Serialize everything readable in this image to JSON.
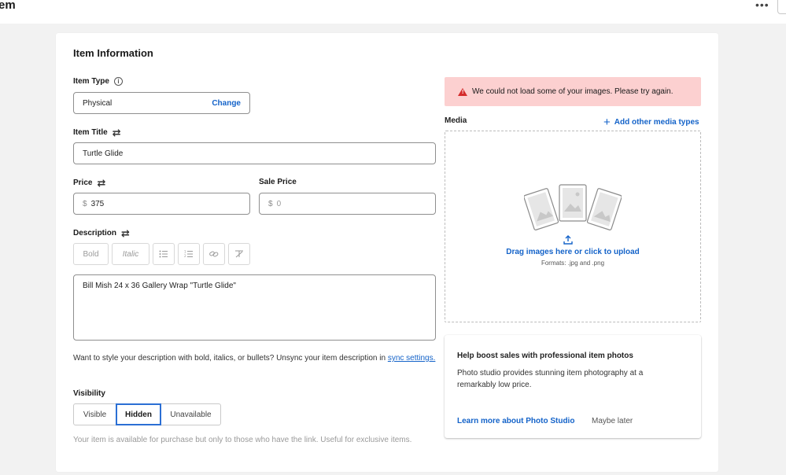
{
  "header": {
    "title": "em",
    "more_icon": "more-horizontal-icon"
  },
  "form": {
    "section_title": "Item Information",
    "item_type": {
      "label": "Item Type",
      "value": "Physical",
      "change_label": "Change"
    },
    "item_title": {
      "label": "Item Title",
      "value": "Turtle Glide"
    },
    "price": {
      "label": "Price",
      "currency": "$",
      "value": "375"
    },
    "sale_price": {
      "label": "Sale Price",
      "currency": "$",
      "placeholder": "0"
    },
    "description": {
      "label": "Description",
      "toolbar": {
        "bold": "Bold",
        "italic": "Italic"
      },
      "value": "Bill Mish 24 x 36 Gallery Wrap \"Turtle Glide\"",
      "help_text": "Want to style your description with bold, italics, or bullets? Unsync your item description in ",
      "help_link": "sync settings."
    },
    "visibility": {
      "label": "Visibility",
      "options": [
        "Visible",
        "Hidden",
        "Unavailable"
      ],
      "selected": "Hidden",
      "help": "Your item is available for purchase but only to those who have the link. Useful for exclusive items."
    }
  },
  "media": {
    "alert": "We could not load some of your images. Please try again.",
    "label": "Media",
    "add_label": "Add other media types",
    "drop_text": "Drag images here or click to upload",
    "formats": "Formats: .jpg and .png"
  },
  "promo": {
    "title": "Help boost sales with professional item photos",
    "body": "Photo studio provides stunning item photography at a remarkably low price.",
    "learn_more": "Learn more about Photo Studio",
    "maybe_later": "Maybe later"
  },
  "colors": {
    "accent": "#1463c9",
    "alert_bg": "#fcd0d0",
    "alert_icon": "#d42b2b",
    "selected_border": "#2b6fd4"
  }
}
